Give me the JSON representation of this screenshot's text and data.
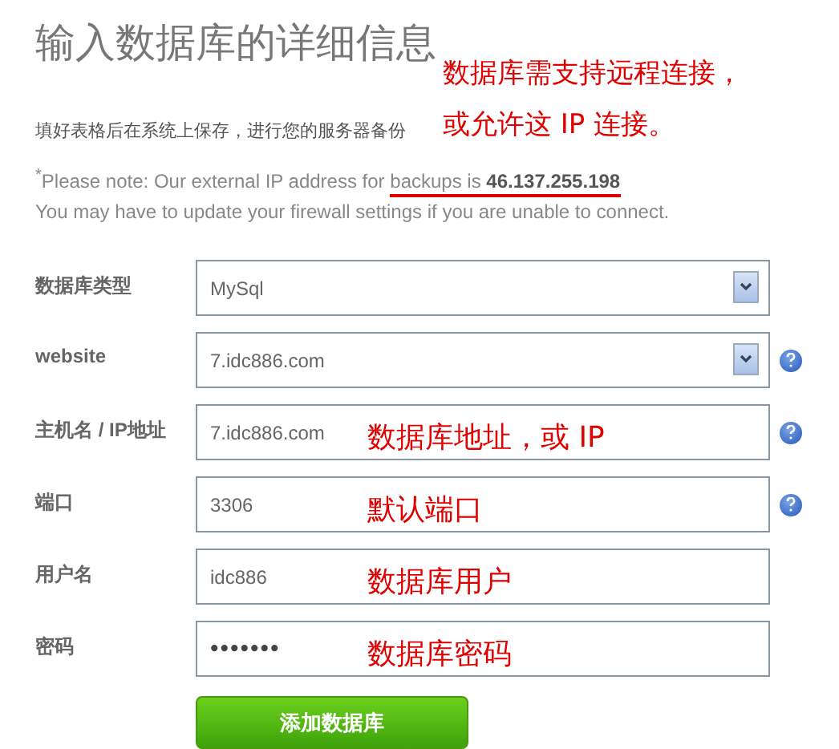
{
  "title": "输入数据库的详细信息",
  "callouts": [
    "数据库需支持远程连接，",
    "或允许这 IP 连接。"
  ],
  "intro": "填好表格后在系统上保存，进行您的服务器备份",
  "notice": {
    "text": "$^{*}$Please note: Our external IP address for ",
    "underlined": "backups is **46.137.255.198**"
  },
  "firewall": "You may have to update your firewall settings if you are unable to connect.",
  "fields": [
    {
      "label": "数据库类型",
      "kind": "select",
      "value": "MySql",
      "help": false
    },
    {
      "label": "website",
      "kind": "select",
      "value": "7.idc886.com",
      "help": true
    },
    {
      "label": "主机名 / IP地址",
      "kind": "text",
      "value": "7.idc886.com",
      "help": true,
      "note": "数据库地址，或 IP"
    },
    {
      "label": "端口",
      "kind": "text",
      "value": "3306",
      "help": true,
      "note": "默认端口"
    },
    {
      "label": "用户名",
      "kind": "text",
      "value": "idc886",
      "help": false,
      "note": "数据库用户"
    },
    {
      "label": "密码",
      "kind": "password",
      "value": "•••••••",
      "help": false,
      "note": "数据库密码"
    }
  ],
  "submit": "添加数据库"
}
